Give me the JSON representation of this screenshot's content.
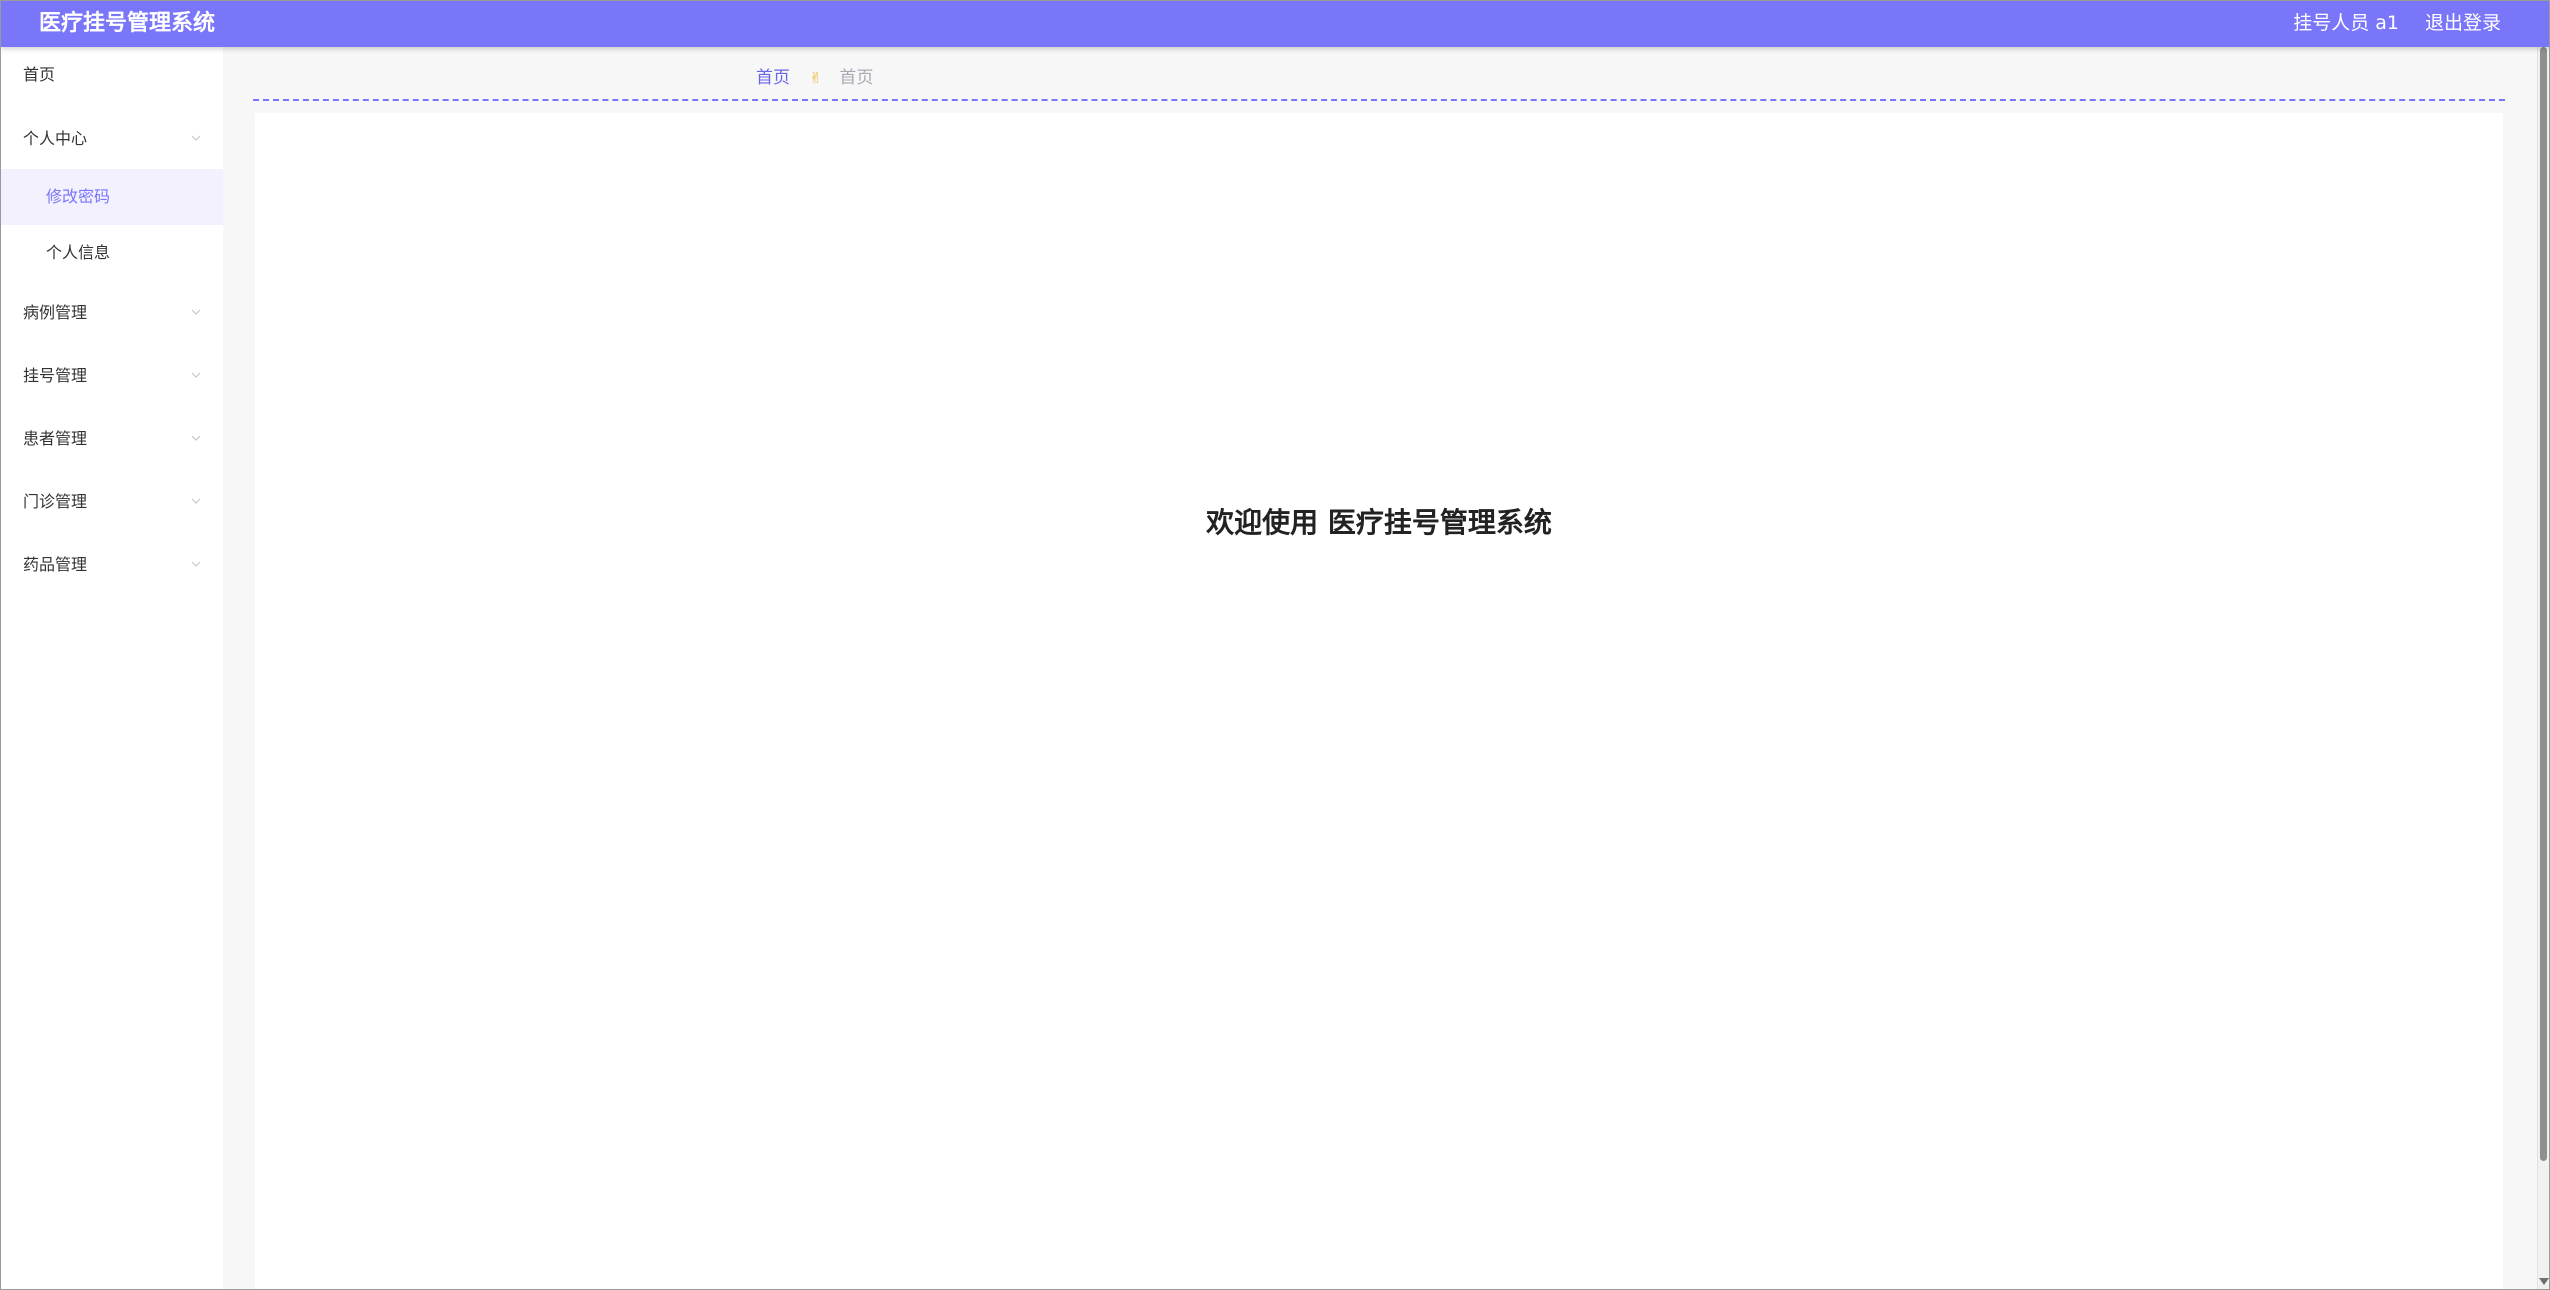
{
  "header": {
    "title": "医疗挂号管理系统",
    "user": "挂号人员 a1",
    "logout": "退出登录"
  },
  "sidebar": {
    "items": [
      {
        "label": "首页"
      },
      {
        "label": "个人中心",
        "children": [
          {
            "label": "修改密码",
            "active": true
          },
          {
            "label": "个人信息"
          }
        ]
      },
      {
        "label": "病例管理"
      },
      {
        "label": "挂号管理"
      },
      {
        "label": "患者管理"
      },
      {
        "label": "门诊管理"
      },
      {
        "label": "药品管理"
      }
    ]
  },
  "breadcrumb": {
    "home": "首页",
    "icon": "hand-icon",
    "current": "首页"
  },
  "main": {
    "welcome": "欢迎使用 医疗挂号管理系统"
  },
  "colors": {
    "accent": "#7a76fa",
    "active_bg": "#f2f1fd",
    "breadcrumb_icon": "#f0b42a"
  }
}
